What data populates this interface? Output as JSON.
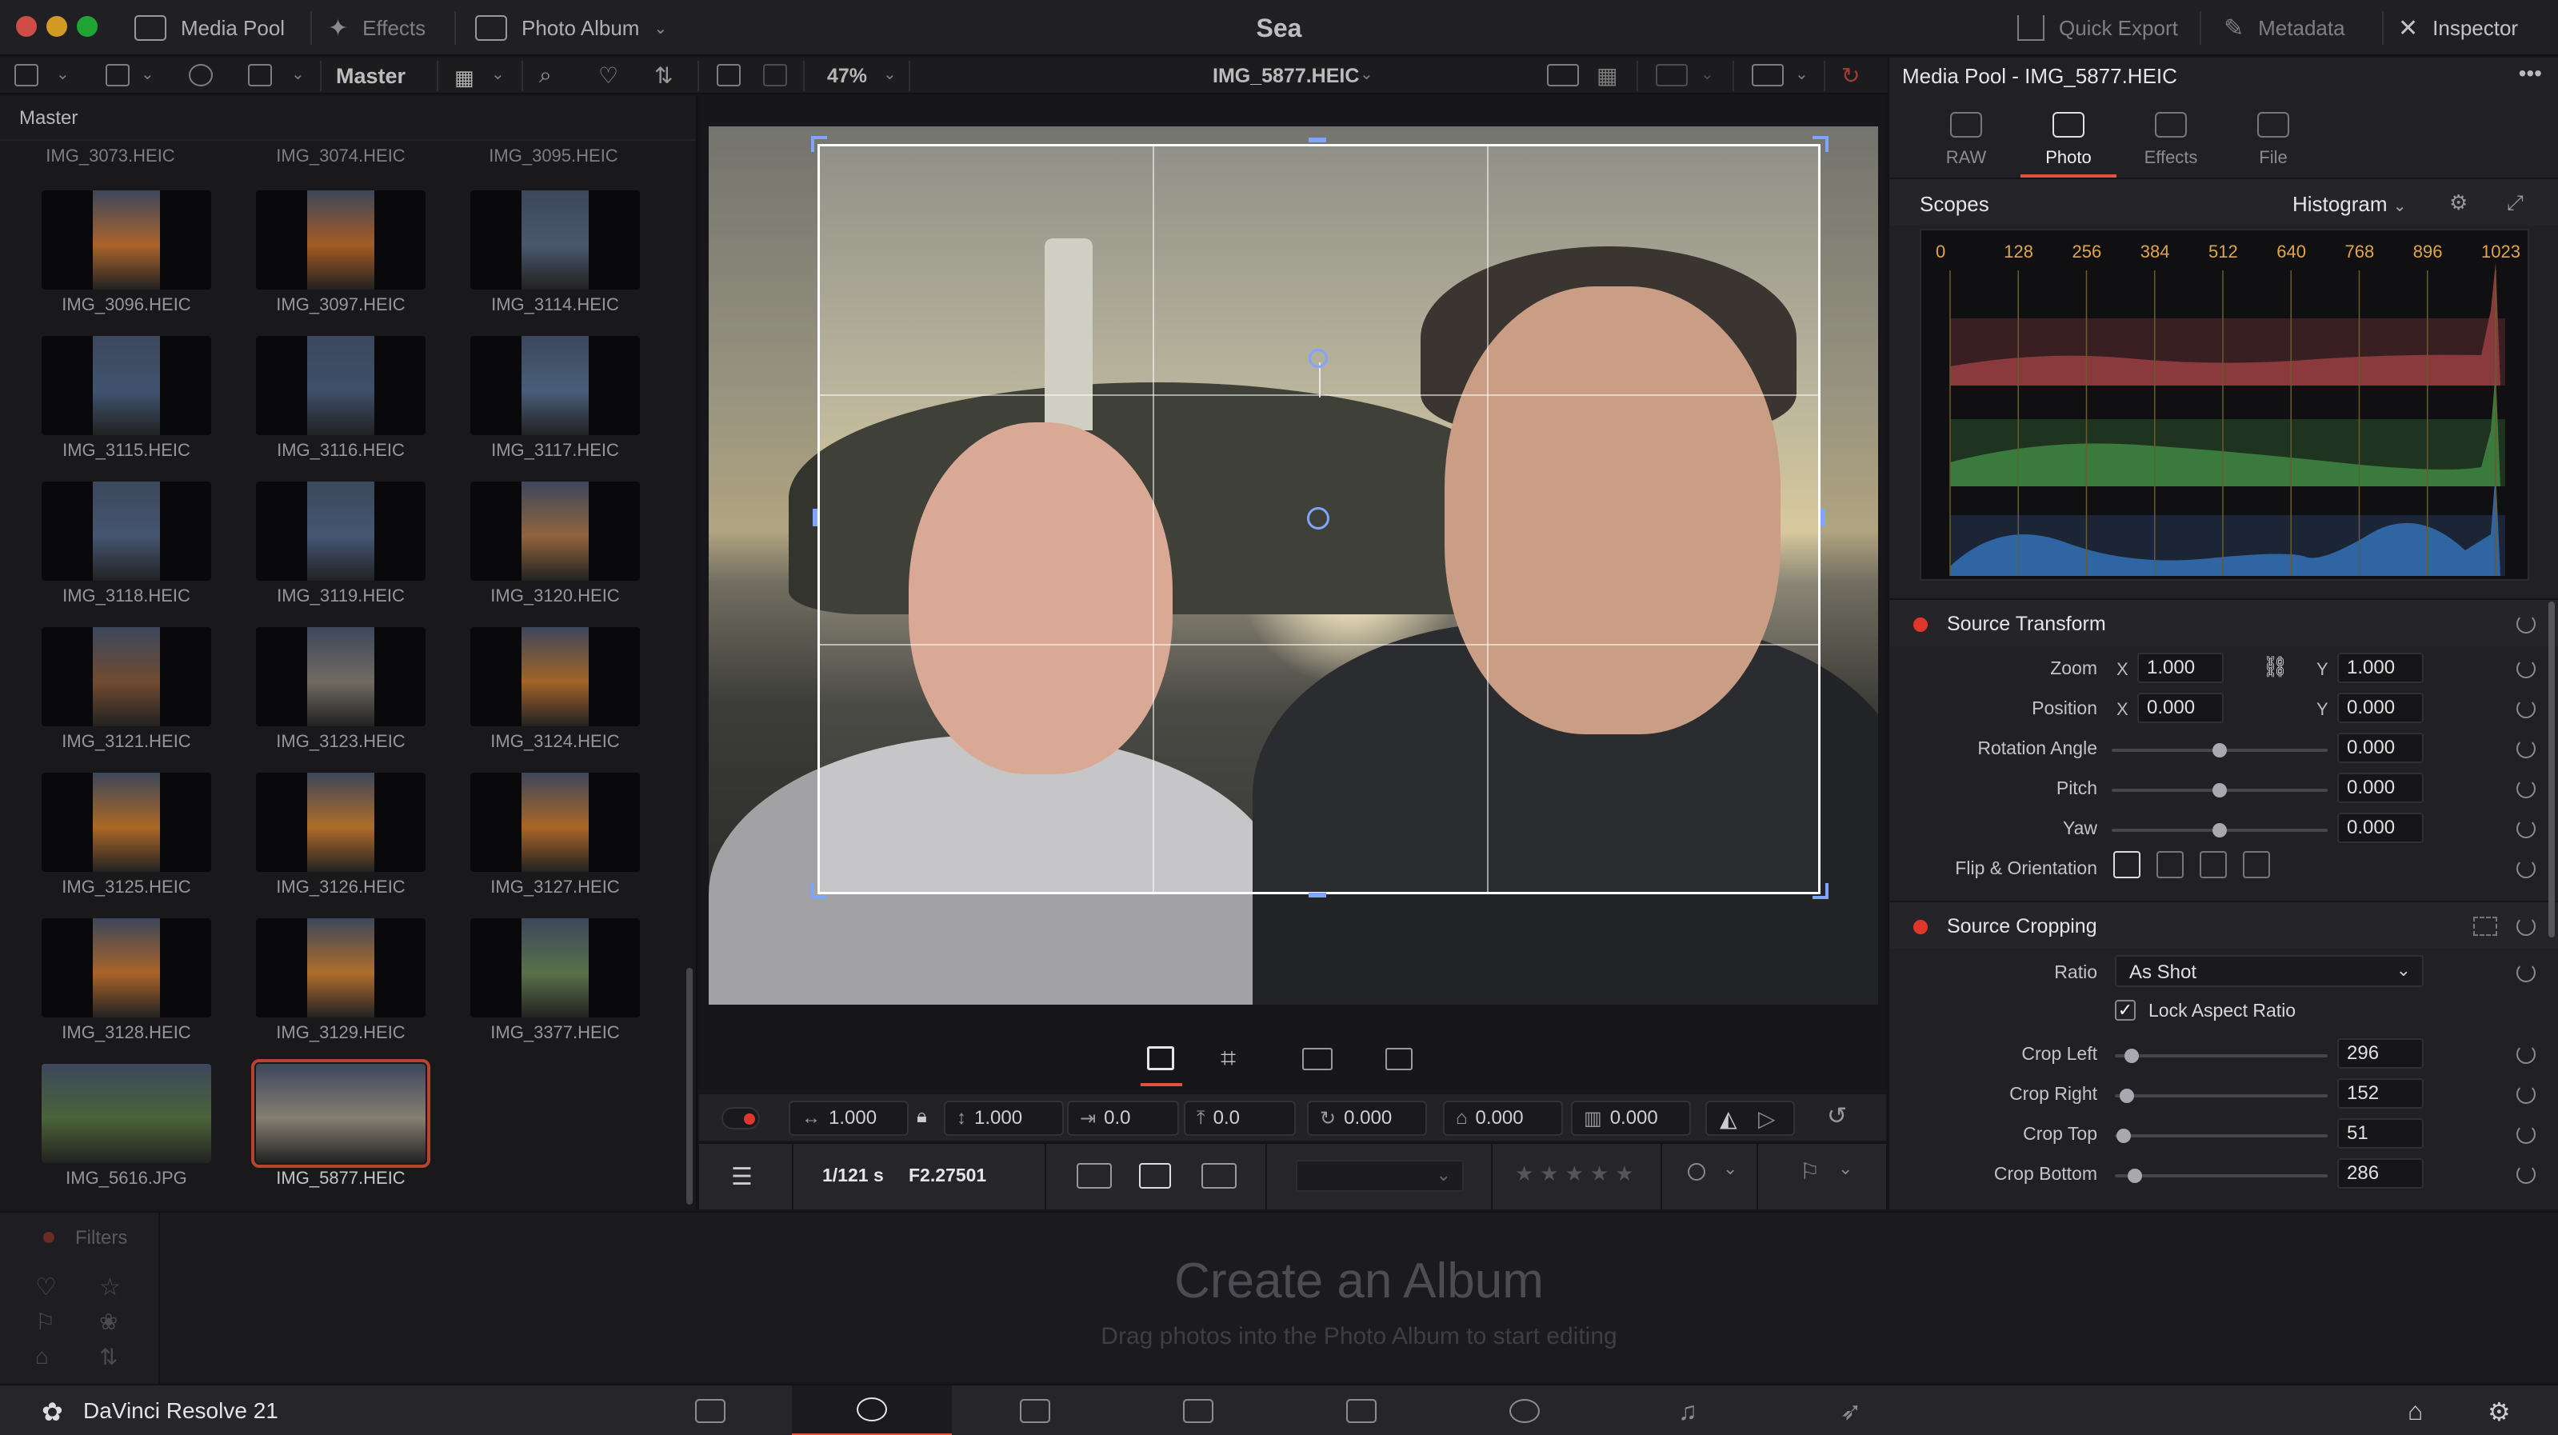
{
  "titlebar": {
    "media_pool": "Media Pool",
    "effects": "Effects",
    "photo_album": "Photo Album",
    "app_title": "Sea",
    "quick_export": "Quick Export",
    "metadata": "Metadata",
    "inspector": "Inspector"
  },
  "toolbar": {
    "bin_name": "Master",
    "zoom": "47%",
    "clip_name": "IMG_5877.HEIC"
  },
  "bin": {
    "header": "Master",
    "top_labels": [
      "IMG_3073.HEIC",
      "IMG_3074.HEIC",
      "IMG_3095.HEIC"
    ],
    "items": [
      {
        "label": "IMG_3096.HEIC",
        "color": "#d07a35"
      },
      {
        "label": "IMG_3097.HEIC",
        "color": "#c8702d"
      },
      {
        "label": "IMG_3114.HEIC",
        "color": "#5a6c86"
      },
      {
        "label": "IMG_3115.HEIC",
        "color": "#4f6688"
      },
      {
        "label": "IMG_3116.HEIC",
        "color": "#4d6182"
      },
      {
        "label": "IMG_3117.HEIC",
        "color": "#5a7394"
      },
      {
        "label": "IMG_3118.HEIC",
        "color": "#55698a"
      },
      {
        "label": "IMG_3119.HEIC",
        "color": "#536a8c"
      },
      {
        "label": "IMG_3120.HEIC",
        "color": "#b27a4c"
      },
      {
        "label": "IMG_3121.HEIC",
        "color": "#8a5c3c"
      },
      {
        "label": "IMG_3123.HEIC",
        "color": "#8a8276"
      },
      {
        "label": "IMG_3124.HEIC",
        "color": "#c67a32"
      },
      {
        "label": "IMG_3125.HEIC",
        "color": "#d27f2e"
      },
      {
        "label": "IMG_3126.HEIC",
        "color": "#d58432"
      },
      {
        "label": "IMG_3127.HEIC",
        "color": "#d07d30"
      },
      {
        "label": "IMG_3128.HEIC",
        "color": "#cf7a32"
      },
      {
        "label": "IMG_3129.HEIC",
        "color": "#d68635"
      },
      {
        "label": "IMG_3377.HEIC",
        "color": "#6e8a5a"
      },
      {
        "label": "IMG_5616.JPG",
        "color": "#5b7a45"
      },
      {
        "label": "IMG_5877.HEIC",
        "color": "#a29a8a"
      }
    ]
  },
  "viewer": {
    "duration": "1/121 s",
    "aperture": "F2.27501"
  },
  "transform_bar": {
    "zoom_x": "1.000",
    "zoom_y": "1.000",
    "pos_x": "0.0",
    "pos_y": "0.0",
    "rotation": "0.000",
    "pitch": "0.000",
    "yaw": "0.000"
  },
  "inspector": {
    "title": "Media Pool - IMG_5877.HEIC",
    "tabs": [
      "RAW",
      "Photo",
      "Effects",
      "File"
    ],
    "scopes_label": "Scopes",
    "scope_type": "Histogram",
    "hist_ticks": [
      "0",
      "128",
      "256",
      "384",
      "512",
      "640",
      "768",
      "896",
      "1023"
    ],
    "source_transform": {
      "title": "Source Transform",
      "zoom_label": "Zoom",
      "zoom_x": "1.000",
      "zoom_y": "1.000",
      "position_label": "Position",
      "position_x": "0.000",
      "position_y": "0.000",
      "rotation_label": "Rotation Angle",
      "rotation": "0.000",
      "pitch_label": "Pitch",
      "pitch": "0.000",
      "yaw_label": "Yaw",
      "yaw": "0.000",
      "flip_label": "Flip & Orientation",
      "x": "X",
      "y": "Y"
    },
    "source_cropping": {
      "title": "Source Cropping",
      "ratio_label": "Ratio",
      "ratio_value": "As Shot",
      "lock_label": "Lock Aspect Ratio",
      "crop_left_label": "Crop Left",
      "crop_left": "296",
      "crop_right_label": "Crop Right",
      "crop_right": "152",
      "crop_top_label": "Crop Top",
      "crop_top": "51",
      "crop_bottom_label": "Crop Bottom",
      "crop_bottom": "286"
    }
  },
  "album": {
    "filters": "Filters",
    "title": "Create an Album",
    "subtitle": "Drag photos into the Photo Album to start editing"
  },
  "bottombar": {
    "app_name": "DaVinci Resolve 21"
  },
  "colors": {
    "accent": "#e0533c",
    "handle": "#7fa5ff",
    "record": "#e0372c"
  }
}
